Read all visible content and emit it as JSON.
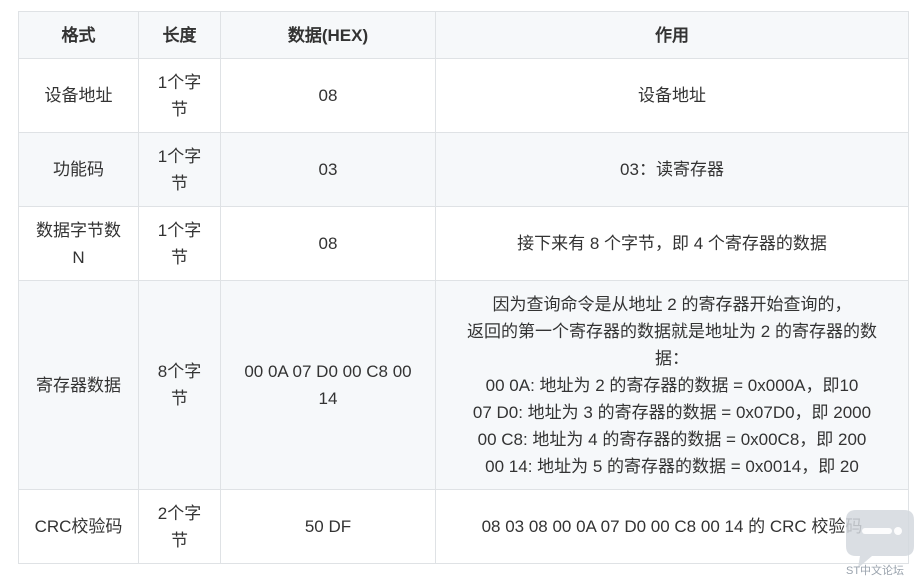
{
  "table": {
    "headers": [
      "格式",
      "长度",
      "数据(HEX)",
      "作用"
    ],
    "rows": [
      {
        "format": [
          "设备地址"
        ],
        "length": [
          "1个字",
          "节"
        ],
        "data": [
          "08"
        ],
        "purpose": [
          "设备地址"
        ]
      },
      {
        "format": [
          "功能码"
        ],
        "length": [
          "1个字",
          "节"
        ],
        "data": [
          "03"
        ],
        "purpose": [
          "03：读寄存器"
        ]
      },
      {
        "format": [
          "数据字节数",
          "N"
        ],
        "length": [
          "1个字",
          "节"
        ],
        "data": [
          "08"
        ],
        "purpose": [
          "接下来有 8 个字节，即 4 个寄存器的数据"
        ]
      },
      {
        "format": [
          "寄存器数据"
        ],
        "length": [
          "8个字",
          "节"
        ],
        "data": [
          "00 0A 07 D0 00 C8 00",
          "14"
        ],
        "purpose": [
          "因为查询命令是从地址 2 的寄存器开始查询的，",
          "返回的第一个寄存器的数据就是地址为 2 的寄存器的数",
          "据：",
          "00 0A: 地址为 2 的寄存器的数据 = 0x000A，即10",
          "07 D0: 地址为 3 的寄存器的数据 = 0x07D0，即 2000",
          "00 C8: 地址为 4 的寄存器的数据 = 0x00C8，即 200",
          "00 14: 地址为 5 的寄存器的数据 = 0x0014，即 20"
        ]
      },
      {
        "format": [
          "CRC校验码"
        ],
        "length": [
          "2个字",
          "节"
        ],
        "data": [
          "50 DF"
        ],
        "purpose": [
          "08 03 08 00 0A 07 D0 00 C8 00 14 的 CRC 校验码"
        ]
      }
    ]
  },
  "watermark": {
    "label": "ST中文论坛",
    "icon": "chat-bubble-icon",
    "color": "#c9d0d8"
  }
}
